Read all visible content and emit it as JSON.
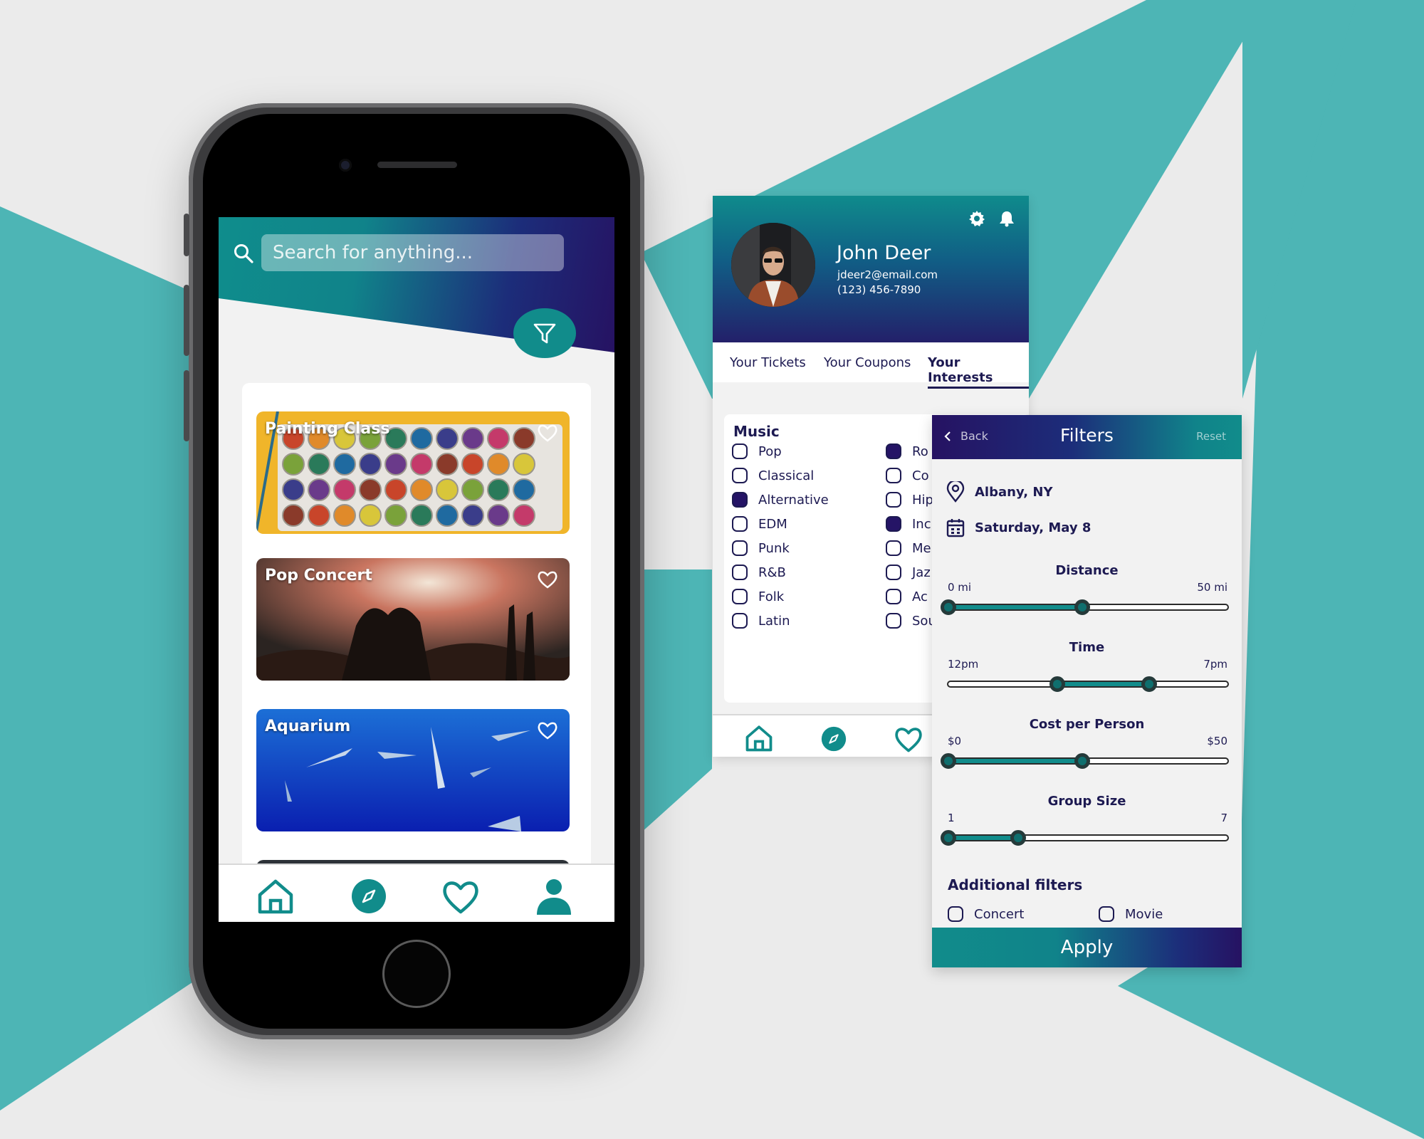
{
  "colors": {
    "teal": "#118c8b",
    "navy": "#1d1a52",
    "purple": "#261262",
    "background": "#ebebeb",
    "accent_bg": "#4db5b5"
  },
  "home": {
    "search_placeholder": "Search for anything...",
    "events": [
      {
        "title": "Painting Class"
      },
      {
        "title": "Pop Concert"
      },
      {
        "title": "Aquarium"
      }
    ],
    "nav": [
      "home-icon",
      "compass-icon",
      "heart-icon",
      "user-icon"
    ]
  },
  "profile": {
    "name": "John Deer",
    "email": "jdeer2@email.com",
    "phone": "(123) 456-7890",
    "tabs": [
      {
        "label": "Your Tickets"
      },
      {
        "label": "Your Coupons"
      },
      {
        "label": "Your Interests",
        "active": true
      }
    ],
    "interests": {
      "section": "Music",
      "left": [
        {
          "label": "Pop",
          "checked": false
        },
        {
          "label": "Classical",
          "checked": false
        },
        {
          "label": "Alternative",
          "checked": true
        },
        {
          "label": "EDM",
          "checked": false
        },
        {
          "label": "Punk",
          "checked": false
        },
        {
          "label": "R&B",
          "checked": false
        },
        {
          "label": "Folk",
          "checked": false
        },
        {
          "label": "Latin",
          "checked": false
        }
      ],
      "right": [
        {
          "label": "Ro",
          "checked": true
        },
        {
          "label": "Co",
          "checked": false
        },
        {
          "label": "Hip",
          "checked": false
        },
        {
          "label": "Inc",
          "checked": true
        },
        {
          "label": "Me",
          "checked": false
        },
        {
          "label": "Jaz",
          "checked": false
        },
        {
          "label": "Ac",
          "checked": false
        },
        {
          "label": "Sou",
          "checked": false
        }
      ]
    }
  },
  "filters": {
    "back": "Back",
    "title": "Filters",
    "reset": "Reset",
    "location": "Albany, NY",
    "date": "Saturday, May 8",
    "sliders": [
      {
        "label": "Distance",
        "min": "0 mi",
        "max": "50 mi",
        "low": 0,
        "high": 0.48
      },
      {
        "label": "Time",
        "min": "12pm",
        "max": "7pm",
        "low": 0.39,
        "high": 0.72
      },
      {
        "label": "Cost per Person",
        "min": "$0",
        "max": "$50",
        "low": 0,
        "high": 0.48
      },
      {
        "label": "Group Size",
        "min": "1",
        "max": "7",
        "low": 0,
        "high": 0.25
      }
    ],
    "additional_title": "Additional filters",
    "additional": [
      {
        "label": "Concert",
        "checked": false
      },
      {
        "label": "Movie",
        "checked": false
      }
    ],
    "apply": "Apply"
  }
}
